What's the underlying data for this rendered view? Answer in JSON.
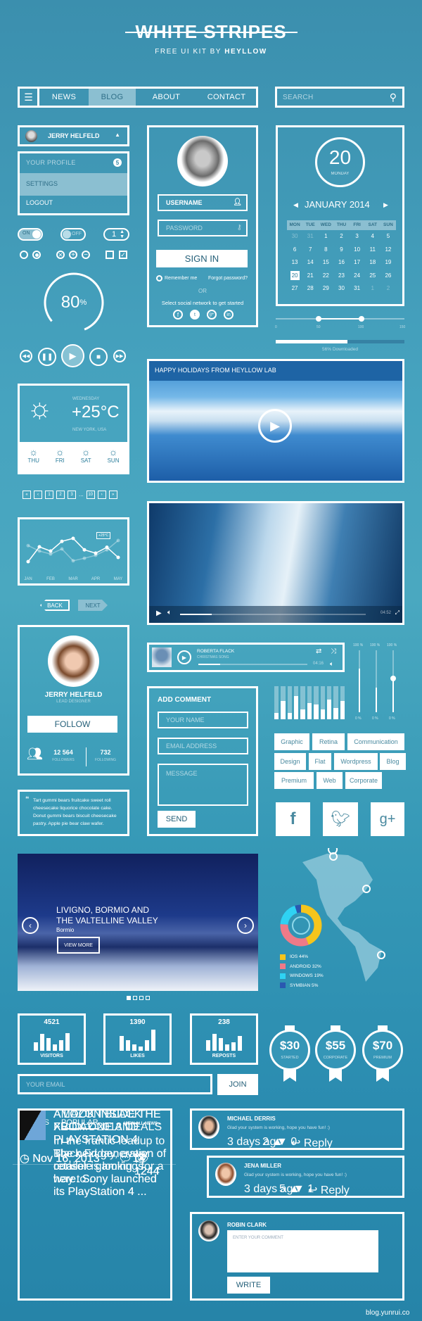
{
  "header": {
    "title": "WHITE STRIPES",
    "subtitle_prefix": "FREE UI KIT BY",
    "subtitle_brand": "HEYLLOW"
  },
  "nav": {
    "items": [
      "NEWS",
      "BLOG",
      "ABOUT",
      "CONTACT"
    ],
    "active": "BLOG"
  },
  "search": {
    "placeholder": "SEARCH"
  },
  "user_menu": {
    "name": "JERRY HELFELD",
    "items": [
      {
        "label": "YOUR PROFILE",
        "badge": "5"
      },
      {
        "label": "SETTINGS"
      },
      {
        "label": "LOGOUT"
      }
    ]
  },
  "controls": {
    "toggle_on": "ON",
    "toggle_off": "OFF",
    "stepper_value": "1",
    "progress_ring_value": "80",
    "progress_ring_unit": "%"
  },
  "login": {
    "username": "USERNAME",
    "password_placeholder": "PASSWORD",
    "sign_in": "SIGN IN",
    "remember": "Remember me",
    "forgot": "Forgot password?",
    "or": "OR",
    "social_prompt": "Select social network to get started"
  },
  "calendar": {
    "day": "20",
    "weekday": "MONDAY",
    "month": "JANUARY 2014",
    "headers": [
      "MON",
      "TUE",
      "WED",
      "THU",
      "FRI",
      "SAT",
      "SUN"
    ],
    "weeks": [
      [
        "30",
        "31",
        "1",
        "2",
        "3",
        "4",
        "5"
      ],
      [
        "6",
        "7",
        "8",
        "9",
        "10",
        "11",
        "12"
      ],
      [
        "13",
        "14",
        "15",
        "16",
        "17",
        "18",
        "19"
      ],
      [
        "20",
        "21",
        "22",
        "23",
        "24",
        "25",
        "26"
      ],
      [
        "27",
        "28",
        "29",
        "30",
        "31",
        "1",
        "2"
      ]
    ],
    "selected": "20"
  },
  "range_slider": {
    "ticks": [
      "0",
      "50",
      "100",
      "150"
    ],
    "low": 50,
    "high": 100
  },
  "download": {
    "percent": 56,
    "label": "56% Downloaded"
  },
  "weather": {
    "day": "WEDNESDAY",
    "temp": "+25°C",
    "location": "NEW YORK, USA",
    "forecast": [
      "THU",
      "FRI",
      "SAT",
      "SUN"
    ]
  },
  "pagination": {
    "items": [
      "«",
      "‹",
      "1",
      "2",
      "3",
      "...",
      "10",
      "›",
      "»"
    ]
  },
  "line_chart": {
    "months": [
      "JAN",
      "FEB",
      "MAR",
      "APR",
      "MAY"
    ],
    "tooltip": "+25°C",
    "series1": [
      20,
      55,
      45,
      68,
      75,
      48,
      40,
      54,
      30
    ],
    "series2": [
      58,
      45,
      38,
      50,
      22,
      28,
      35,
      48,
      70
    ]
  },
  "back_next": {
    "back": "BACK",
    "next": "NEXT"
  },
  "video1": {
    "title": "HAPPY HOLIDAYS FROM HEYLLOW LAB"
  },
  "video2": {
    "time": "04:52",
    "progress": 0.17
  },
  "profile": {
    "name": "JERRY HELFELD",
    "role": "LEAD DESIGNER",
    "follow": "FOLLOW",
    "followers": "12 564",
    "followers_label": "FOLLOWERS",
    "following": "732",
    "following_label": "FOLLOWING"
  },
  "music": {
    "artist": "ROBERTA FLACK",
    "song": "CHRISTMAS SONG",
    "time": "04:16",
    "progress": 0.2
  },
  "vsliders": {
    "top_labels": [
      "100 %",
      "100 %",
      "100 %"
    ],
    "bottom_labels": [
      "0 %",
      "0 %",
      "0 %"
    ],
    "values": [
      0.7,
      0.4,
      0.55
    ]
  },
  "equalizer": {
    "values": [
      0.2,
      0.55,
      0.2,
      0.7,
      0.3,
      0.5,
      0.45,
      0.3,
      0.6,
      0.35,
      0.55
    ]
  },
  "comment_form": {
    "title": "ADD COMMENT",
    "name": "YOUR NAME",
    "email": "EMAIL ADDRESS",
    "message": "MESSAGE",
    "send": "SEND"
  },
  "tags": [
    "Graphic",
    "Retina",
    "Communication",
    "Design",
    "Flat",
    "Wordpress",
    "Blog",
    "Premium",
    "Web",
    "Corporate"
  ],
  "quote": {
    "text": "Tart gummi bears fruitcake sweet roll cheesecake liquorice chocolate cake. Donut gummi bears biscuit cheesecake pastry. Apple pie bear claw wafer."
  },
  "slider": {
    "title1": "LIVIGNO,  BORMIO AND",
    "title2": "THE VALTELLINE VALLEY",
    "subtitle": "Bormio",
    "button": "VIEW MORE",
    "slides": 4,
    "active": 0
  },
  "donut": {
    "segments": [
      {
        "label": "IOS  44%",
        "value": 44,
        "color": "#f5c51c"
      },
      {
        "label": "ANDROID  32%",
        "value": 32,
        "color": "#ee7a88"
      },
      {
        "label": "WINDOWS  19%",
        "value": 19,
        "color": "#2fd2f3"
      },
      {
        "label": "SYMBIAN  5%",
        "value": 5,
        "color": "#2a58b0"
      }
    ]
  },
  "stats": [
    {
      "value": "4521",
      "label": "VISITORS",
      "bars": [
        0.4,
        0.8,
        0.6,
        0.3,
        0.5,
        0.85
      ]
    },
    {
      "value": "1390",
      "label": "LIKES",
      "bars": [
        0.7,
        0.5,
        0.3,
        0.2,
        0.5,
        1
      ]
    },
    {
      "value": "238",
      "label": "REPOSTS",
      "bars": [
        0.5,
        0.8,
        0.6,
        0.3,
        0.4,
        0.7
      ]
    }
  ],
  "pricing": [
    {
      "price": "$30",
      "plan": "STARTED"
    },
    {
      "price": "$55",
      "plan": "CORPORATE"
    },
    {
      "price": "$70",
      "plan": "PREMIUM"
    }
  ],
  "newsletter": {
    "placeholder": "YOUR EMAIL",
    "button": "JOIN"
  },
  "news": {
    "tabs": [
      "NEWS",
      "POPULAR"
    ],
    "view_all": "VIEW ALL NEWS",
    "items": [
      {
        "title": "A LOOK INSIDE THE XBOX ONE AND PLAYSTATION 4",
        "text": "The next generation of console gaming is here. Sony launched its PlayStation 4 ...",
        "date": "Nov 16, 2013",
        "comments": "14",
        "views": "1244"
      },
      {
        "title": "AMAZON BLACK FRIDAY 2013 DEALS",
        "text": "In the frantic leadup to Black Friday, every retailer is looking for a way to ...",
        "date": "Nov 16, 2013",
        "comments": "14",
        "views": "1244"
      },
      {
        "title": "A LOOK INSIDE THE XBOX ONE AND PLAYSTATION 4",
        "text": "The next generation of console gaming is here. Sony launched its PlayStation 4 ...",
        "date": "Nov 16, 2013",
        "comments": "14",
        "views": "1244"
      }
    ]
  },
  "comments": [
    {
      "name": "MICHAEL DERRIS",
      "text": "Glad your system is working, hope you have fun! :)",
      "time": "3 days ago",
      "up": "2",
      "down": "0",
      "reply": "Reply"
    },
    {
      "name": "JENA MILLER",
      "text": "Glad your system is working, hope you have fun! :)",
      "time": "3 days ago",
      "up": "5",
      "down": "1",
      "reply": "Reply"
    }
  ],
  "write_comment": {
    "name": "ROBIN CLARK",
    "placeholder": "ENTER YOUR COMMENT",
    "button": "WRITE"
  },
  "watermark": "blog.yunrui.co"
}
